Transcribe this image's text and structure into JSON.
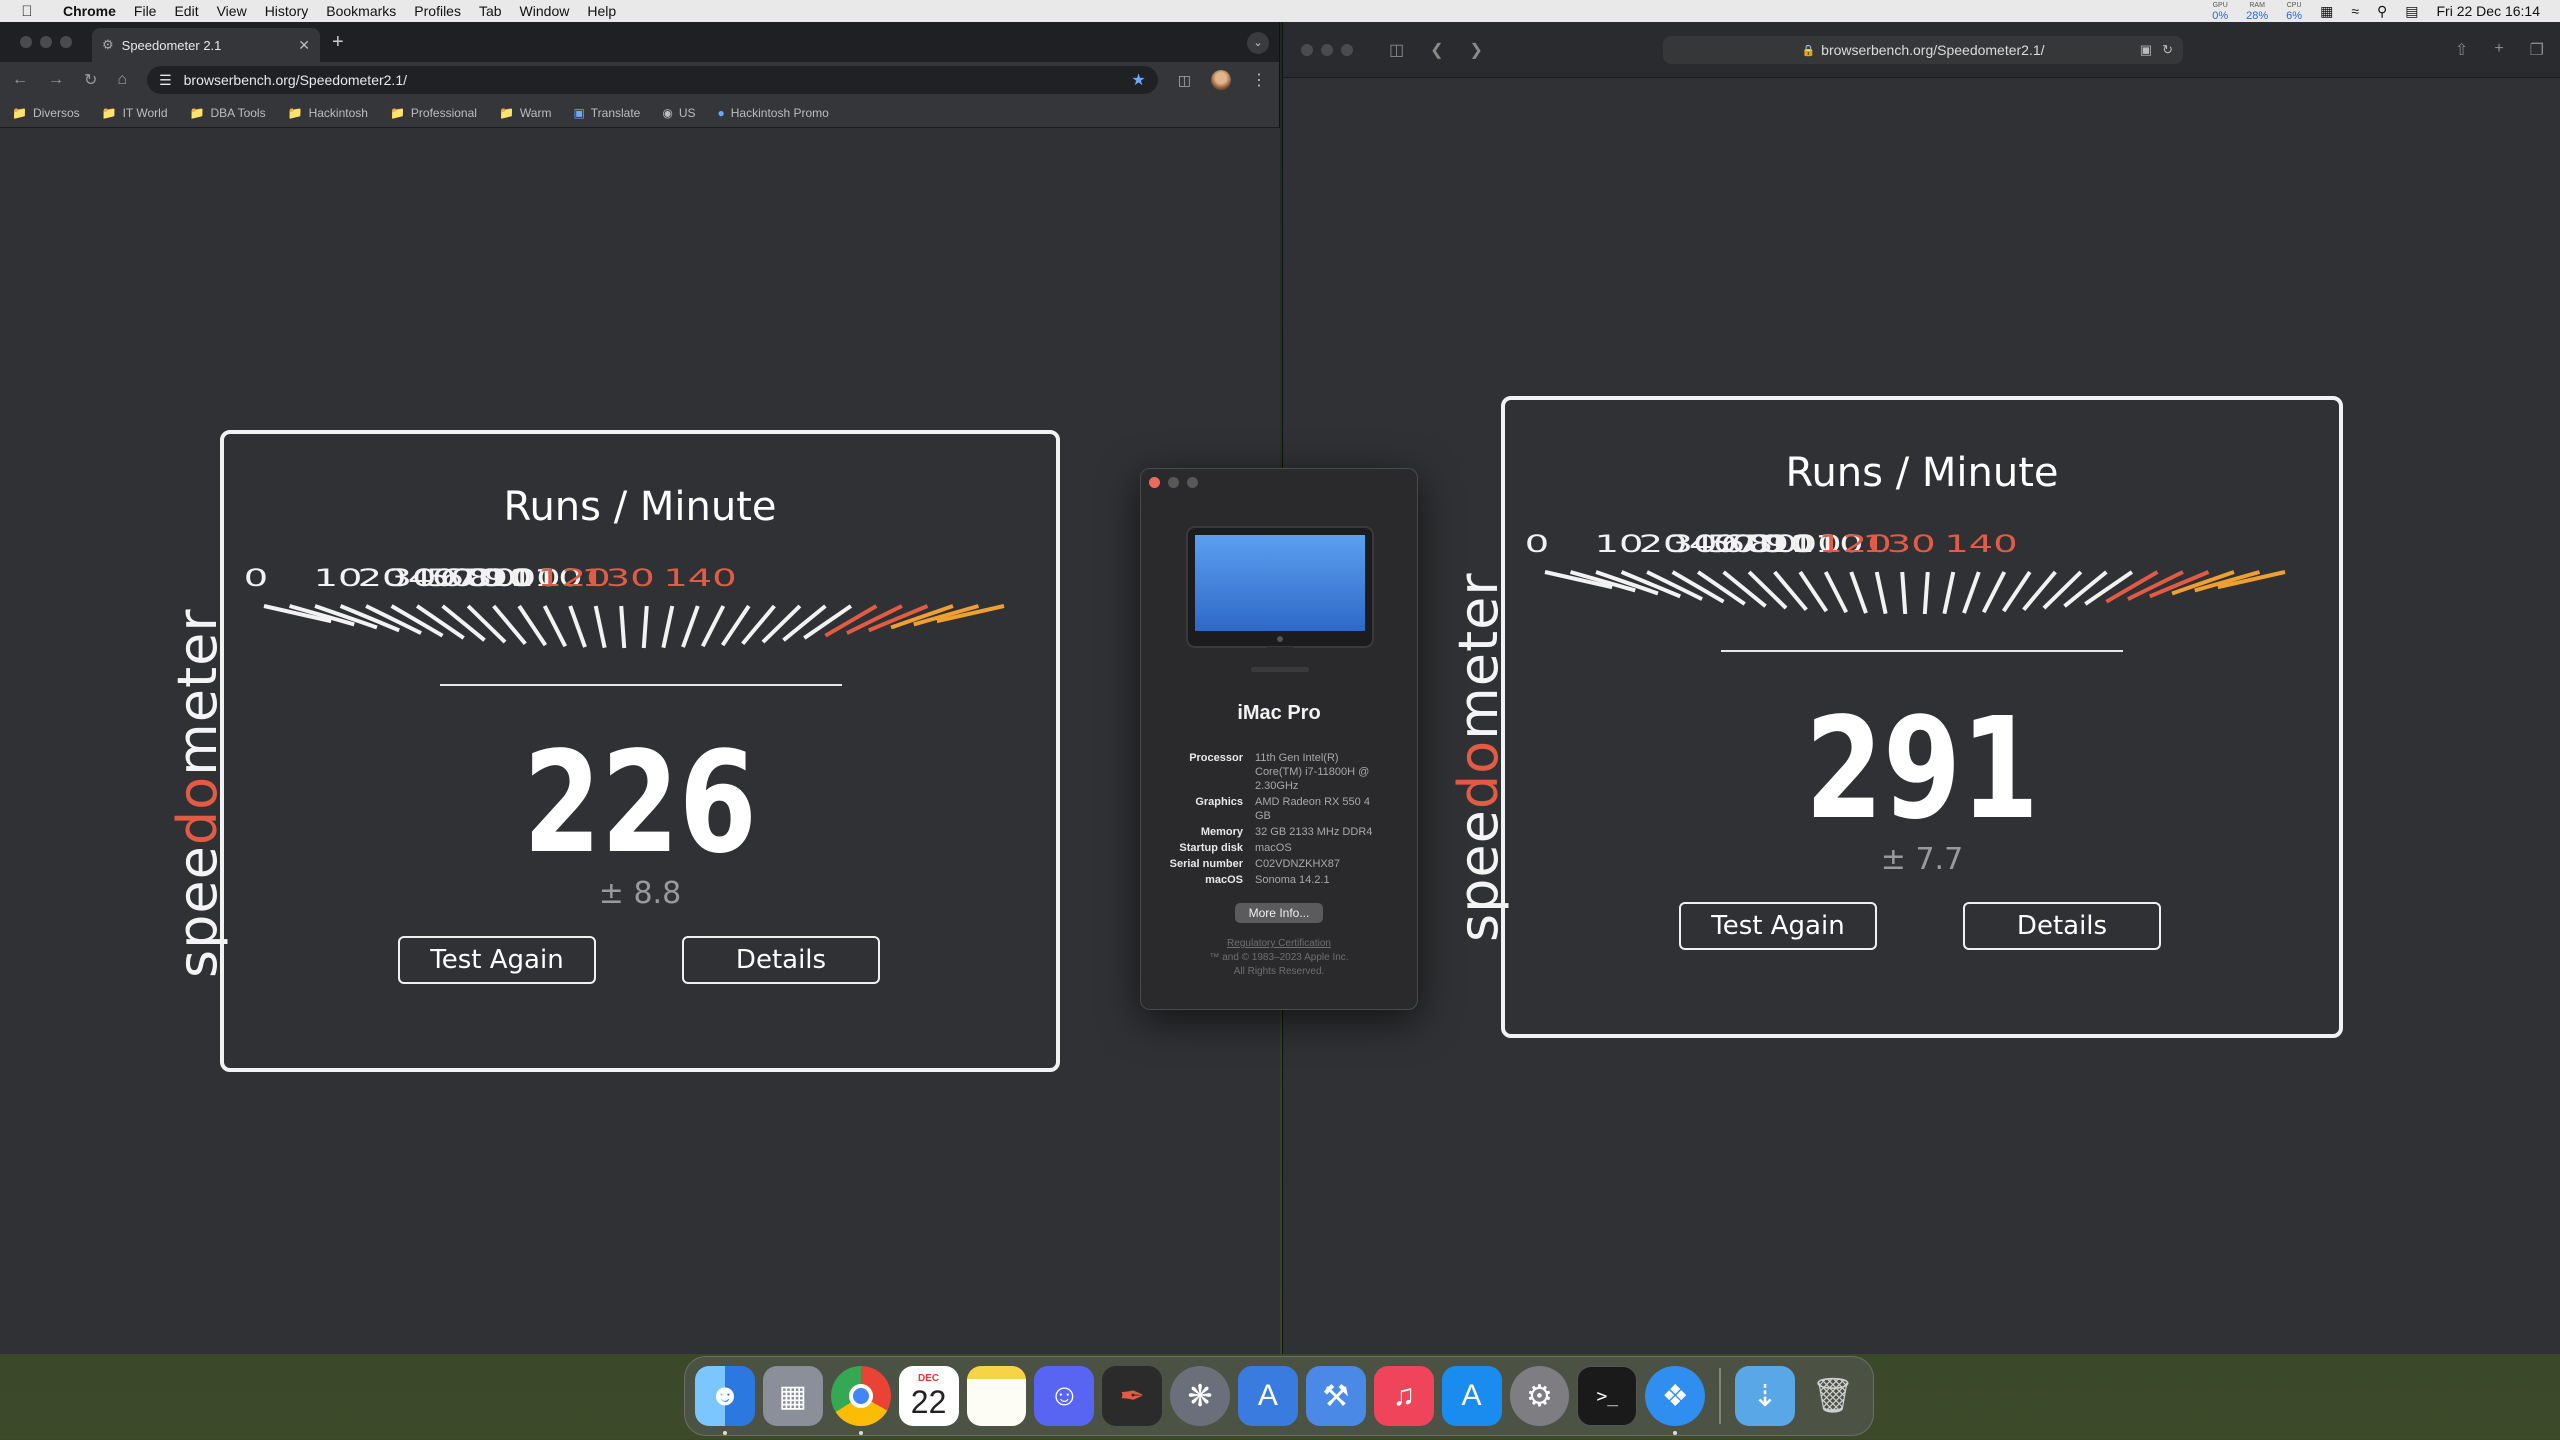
{
  "menubar": {
    "app_name": "Chrome",
    "items": [
      "File",
      "Edit",
      "View",
      "History",
      "Bookmarks",
      "Profiles",
      "Tab",
      "Window",
      "Help"
    ],
    "stats": [
      {
        "label": "GPU",
        "value": "0%"
      },
      {
        "label": "RAM",
        "value": "28%"
      },
      {
        "label": "CPU",
        "value": "6%"
      }
    ],
    "clock": "Fri 22 Dec  16:14"
  },
  "chrome": {
    "tab_title": "Speedometer 2.1",
    "url": "browserbench.org/Speedometer2.1/",
    "bookmarks": [
      {
        "label": "Diversos",
        "icon": "folder-icon"
      },
      {
        "label": "IT World",
        "icon": "folder-icon"
      },
      {
        "label": "DBA Tools",
        "icon": "folder-icon"
      },
      {
        "label": "Hackintosh",
        "icon": "folder-icon"
      },
      {
        "label": "Professional",
        "icon": "folder-icon"
      },
      {
        "label": "Warm",
        "icon": "folder-icon"
      },
      {
        "label": "Translate",
        "icon": "translate-icon"
      },
      {
        "label": "US",
        "icon": "globe-icon"
      },
      {
        "label": "Hackintosh Promo",
        "icon": "apple-icon"
      }
    ]
  },
  "speedometer_left": {
    "heading": "Runs / Minute",
    "score": "226",
    "margin": "± 8.8",
    "test_again": "Test Again",
    "details": "Details",
    "brand_pre": "spee",
    "brand_do": "do",
    "brand_post": "meter"
  },
  "speedometer_right": {
    "heading": "Runs / Minute",
    "score": "291",
    "margin": "± 7.7",
    "test_again": "Test Again",
    "details": "Details",
    "brand_pre": "spee",
    "brand_do": "do",
    "brand_post": "meter"
  },
  "gauge": {
    "ticks": [
      "0",
      "10",
      "20",
      "30",
      "40",
      "50",
      "60",
      "70",
      "80",
      "90",
      "100",
      "110",
      "120",
      "130",
      "140"
    ],
    "colors": {
      "normal": "#f2f2f2",
      "hot": "#e25b45",
      "max": "#f0a030"
    }
  },
  "safari": {
    "url": "browserbench.org/Speedometer2.1/"
  },
  "about_mac": {
    "model": "iMac Pro",
    "specs": [
      {
        "key": "Processor",
        "value": "11th Gen Intel(R) Core(TM) i7-11800H @ 2.30GHz"
      },
      {
        "key": "Graphics",
        "value": "AMD Radeon RX 550 4 GB"
      },
      {
        "key": "Memory",
        "value": "32 GB 2133 MHz DDR4"
      },
      {
        "key": "Startup disk",
        "value": "macOS"
      },
      {
        "key": "Serial number",
        "value": "C02VDNZKHX87"
      },
      {
        "key": "macOS",
        "value": "Sonoma 14.2.1"
      }
    ],
    "more_info": "More Info...",
    "regulatory": "Regulatory Certification",
    "copyright_1": "™ and © 1983–2023 Apple Inc.",
    "copyright_2": "All Rights Reserved."
  },
  "dock": {
    "apps": [
      {
        "name": "Finder",
        "icon": "finder-icon",
        "color": "#3d9bf0"
      },
      {
        "name": "Launchpad",
        "icon": "launchpad-icon",
        "color": "#8a8f99"
      },
      {
        "name": "Chrome",
        "icon": "chrome-icon",
        "color": "#e8e8e8"
      },
      {
        "name": "Calendar",
        "icon": "calendar-icon",
        "color": "#ffffff"
      },
      {
        "name": "Notes",
        "icon": "notes-icon",
        "color": "#f7d348"
      },
      {
        "name": "Discord",
        "icon": "discord-icon",
        "color": "#5865f2"
      },
      {
        "name": "Pen app",
        "icon": "pen-icon",
        "color": "#2b2b2b"
      },
      {
        "name": "DaVinci Resolve",
        "icon": "film-reel-icon",
        "color": "#6a6f7a"
      },
      {
        "name": "Instruments",
        "icon": "compass-icon",
        "color": "#3a7be0"
      },
      {
        "name": "Xcode",
        "icon": "hammer-icon",
        "color": "#4a8ae6"
      },
      {
        "name": "Music",
        "icon": "music-icon",
        "color": "#f0445a"
      },
      {
        "name": "App Store",
        "icon": "app-store-icon",
        "color": "#1a8cf0"
      },
      {
        "name": "System Settings",
        "icon": "gear-icon",
        "color": "#7d7d82"
      },
      {
        "name": "Terminal",
        "icon": "terminal-icon",
        "color": "#1a1a1a"
      },
      {
        "name": "Safari",
        "icon": "safari-icon",
        "color": "#2f8ef0"
      }
    ],
    "calendar_month": "DEC",
    "calendar_day": "22",
    "downloads_icon": "downloads-folder-icon",
    "trash_icon": "trash-icon"
  }
}
